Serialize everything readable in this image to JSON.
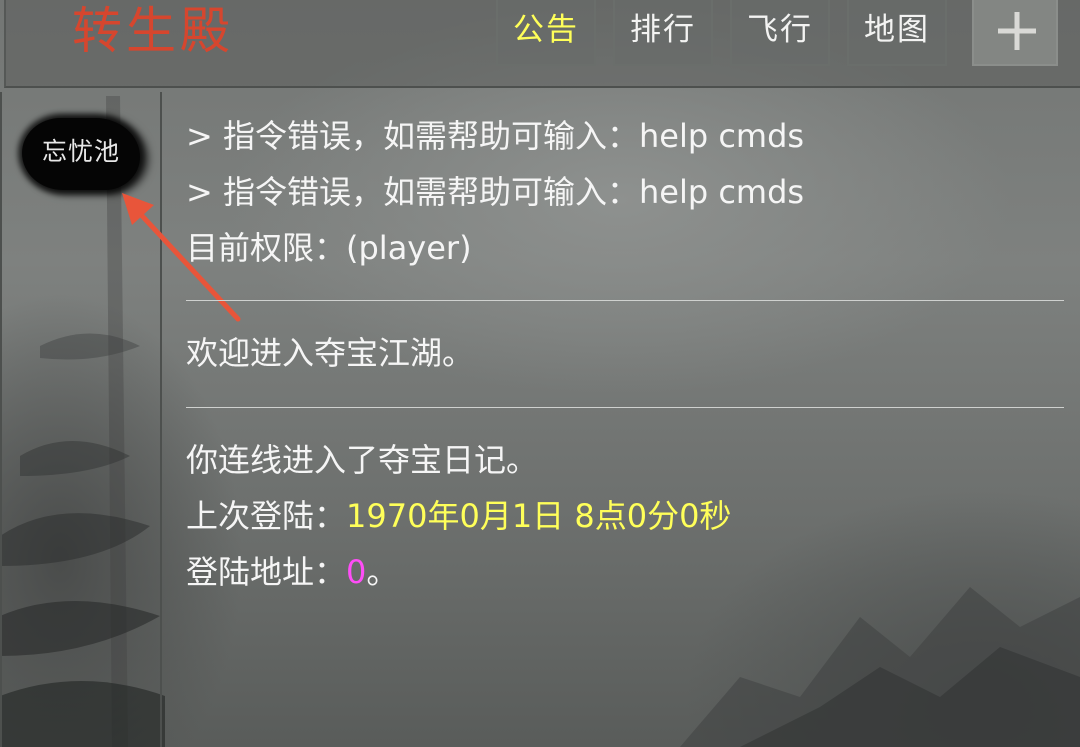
{
  "header": {
    "title": "转生殿",
    "tabs": [
      {
        "label": "公告",
        "active": true
      },
      {
        "label": "排行",
        "active": false
      },
      {
        "label": "飞行",
        "active": false
      },
      {
        "label": "地图",
        "active": false
      }
    ],
    "plus_icon": "plus-icon"
  },
  "sidebar": {
    "room_button_label": "忘忧池"
  },
  "log": {
    "lines": [
      "> 指令错误，如需帮助可输入：help cmds",
      "> 指令错误，如需帮助可输入：help cmds",
      "目前权限：(player)",
      "欢迎进入夺宝江湖。",
      "你连线进入了夺宝日记。"
    ],
    "last_login_label": "上次登陆：",
    "last_login_value": "1970年0月1日 8点0分0秒",
    "login_address_label": "登陆地址：",
    "login_address_value": "0",
    "login_address_suffix": "。"
  },
  "colors": {
    "title": "#e0442a",
    "active_tab": "#ffff59",
    "highlight_yellow": "#ffff59",
    "highlight_magenta": "#ff4df7",
    "annotation_arrow": "#e8553a"
  }
}
